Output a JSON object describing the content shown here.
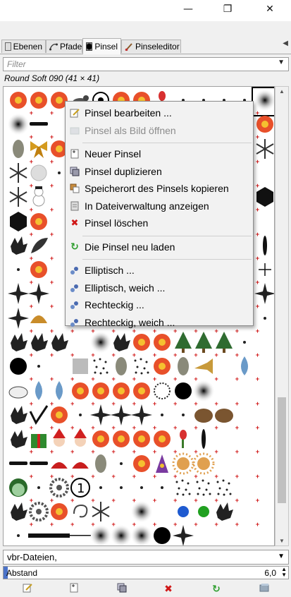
{
  "window": {
    "minimize_glyph": "—",
    "maximize_glyph": "❐",
    "close_glyph": "✕"
  },
  "tabs": [
    {
      "label": "Ebenen",
      "icon": "layers-icon",
      "active": false
    },
    {
      "label": "Pfade",
      "icon": "paths-icon",
      "active": false
    },
    {
      "label": "Pinsel",
      "icon": "brush-icon",
      "active": true
    },
    {
      "label": "Pinseleditor",
      "icon": "brush-editor-icon",
      "active": false
    }
  ],
  "filter": {
    "placeholder": "Filter"
  },
  "brush_title": "Round Soft 090 (41 × 41)",
  "context_menu": {
    "items": [
      {
        "label": "Pinsel bearbeiten ...",
        "icon": "edit-icon",
        "enabled": true
      },
      {
        "label": "Pinsel als Bild öffnen",
        "icon": "open-as-image-icon",
        "enabled": false
      },
      {
        "separator": true
      },
      {
        "label": "Neuer Pinsel",
        "icon": "new-brush-icon",
        "enabled": true
      },
      {
        "label": "Pinsel duplizieren",
        "icon": "duplicate-icon",
        "enabled": true
      },
      {
        "label": "Speicherort des Pinsels kopieren",
        "icon": "copy-location-icon",
        "enabled": true
      },
      {
        "label": "In Dateiverwaltung anzeigen",
        "icon": "file-manager-icon",
        "enabled": true
      },
      {
        "label": "Pinsel löschen",
        "icon": "delete-icon",
        "enabled": true
      },
      {
        "separator": true
      },
      {
        "label": "Die Pinsel neu laden",
        "icon": "refresh-icon",
        "enabled": true
      },
      {
        "separator": true
      },
      {
        "label": "Elliptisch ...",
        "icon": "brush-generated-icon",
        "enabled": true
      },
      {
        "label": "Elliptisch, weich ...",
        "icon": "brush-generated-icon",
        "enabled": true
      },
      {
        "label": "Rechteckig ...",
        "icon": "brush-generated-icon",
        "enabled": true
      },
      {
        "label": "Rechteckig, weich ...",
        "icon": "brush-generated-icon",
        "enabled": true
      }
    ]
  },
  "tag_combo": {
    "value": "vbr-Dateien,"
  },
  "spacing": {
    "label": "Abstand",
    "value": "6,0"
  },
  "bottom_buttons": [
    {
      "name": "edit-brush-button",
      "icon": "edit-icon"
    },
    {
      "name": "new-brush-button",
      "icon": "new-brush-icon"
    },
    {
      "name": "duplicate-brush-button",
      "icon": "duplicate-icon"
    },
    {
      "name": "delete-brush-button",
      "icon": "delete-icon"
    },
    {
      "name": "refresh-brushes-button",
      "icon": "refresh-icon"
    },
    {
      "name": "open-as-image-button",
      "icon": "open-as-image-icon"
    }
  ],
  "colors": {
    "delete": "#d01818",
    "refresh": "#2e9e2e",
    "active_tab": "#f8f8f8",
    "selection": "#4a72c8"
  },
  "brush_grid": {
    "rows": [
      [
        "flower",
        "flower",
        "flower",
        "bird",
        "outline",
        "flower",
        "flower",
        "bud",
        "dot",
        "dot",
        "dot",
        "dot",
        "blur"
      ],
      [
        "blur",
        "dash",
        "blank",
        "blank",
        "blank",
        "blank",
        "blank",
        "blank",
        "blank",
        "blank",
        "blank",
        "dot",
        "flower"
      ],
      [
        "leaf",
        "ribbon",
        "flower",
        "blank",
        "blank",
        "blank",
        "blank",
        "blank",
        "blank",
        "blank",
        "blank",
        "blank",
        "snowflake"
      ],
      [
        "snowflake",
        "ball",
        "dot",
        "blank",
        "blank",
        "blank",
        "blank",
        "blank",
        "blank",
        "blank",
        "blank",
        "blank",
        "blank"
      ],
      [
        "snowflake",
        "snowman",
        "blank",
        "blank",
        "blank",
        "blank",
        "blank",
        "blank",
        "blank",
        "blank",
        "blank",
        "blank",
        "hexagon"
      ],
      [
        "hexagon",
        "flower",
        "blank",
        "blank",
        "blank",
        "blank",
        "blank",
        "blank",
        "blank",
        "blank",
        "blank",
        "blank",
        "blank"
      ],
      [
        "splash",
        "feather",
        "blank",
        "blank",
        "blank",
        "blank",
        "blank",
        "blank",
        "blank",
        "blank",
        "blank",
        "blank",
        "blade"
      ],
      [
        "dot",
        "flower",
        "blank",
        "blank",
        "blank",
        "blank",
        "blank",
        "blank",
        "blank",
        "blank",
        "blank",
        "blank",
        "cross"
      ],
      [
        "star",
        "star",
        "blank",
        "blank",
        "blank",
        "blank",
        "blank",
        "blank",
        "blank",
        "blank",
        "blank",
        "blank",
        "star"
      ],
      [
        "star",
        "dome",
        "blank",
        "blank",
        "blank",
        "blank",
        "blank",
        "blank",
        "blank",
        "blank",
        "blank",
        "blank",
        "dot"
      ],
      [
        "splash",
        "splash",
        "splash",
        "blank",
        "blur",
        "splash",
        "flower",
        "flower",
        "tree",
        "tree",
        "tree",
        "dot",
        "blank"
      ],
      [
        "circle",
        "dot",
        "blank",
        "square",
        "grain",
        "leaf",
        "grain",
        "flower",
        "leaf",
        "trumpet",
        "blank",
        "drop",
        "blank"
      ],
      [
        "cloud",
        "drop",
        "drop",
        "flower",
        "flower",
        "flower",
        "flower",
        "wreath",
        "circle",
        "blur",
        "blank",
        "blank",
        "blank"
      ],
      [
        "splash",
        "check",
        "flower",
        "dot",
        "star",
        "star",
        "star",
        "dot",
        "dot",
        "rock",
        "rock",
        "blank",
        "blank"
      ],
      [
        "splash",
        "gift",
        "santa",
        "santa",
        "flower",
        "flower",
        "flower",
        "flower",
        "bud",
        "blade",
        "blank",
        "blank",
        "blank"
      ],
      [
        "dash",
        "dash",
        "hat",
        "hat",
        "leaf",
        "dot",
        "flower",
        "wizard",
        "sun",
        "sun",
        "blank",
        "blank",
        "blank"
      ],
      [
        "orb",
        "dot",
        "gear",
        "one",
        "dot",
        "dot",
        "dot",
        "dot",
        "grain",
        "grain",
        "grain",
        "blank",
        "blank"
      ],
      [
        "splash",
        "gear",
        "flower",
        "swirl",
        "snowflake",
        "blank",
        "blur",
        "blank",
        "blue-ball",
        "green-ball",
        "splash",
        "blank",
        "blank"
      ],
      [
        "dot",
        "bar",
        "bar",
        "line",
        "blur",
        "blur",
        "blur",
        "circle",
        "star",
        "blank",
        "blank",
        "blank",
        "blank"
      ]
    ]
  }
}
